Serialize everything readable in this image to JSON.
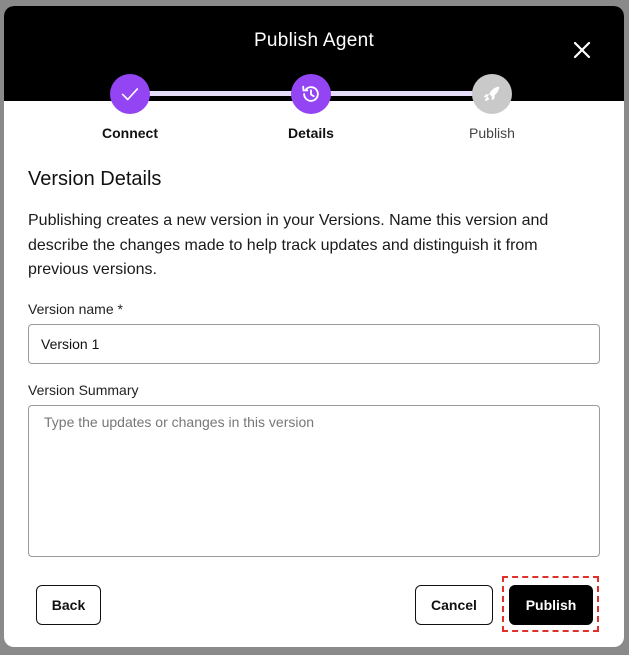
{
  "dialog": {
    "title": "Publish Agent",
    "close_icon": "close-icon"
  },
  "stepper": {
    "steps": [
      {
        "label": "Connect",
        "state": "complete",
        "icon": "check-icon"
      },
      {
        "label": "Details",
        "state": "active",
        "icon": "history-icon"
      },
      {
        "label": "Publish",
        "state": "pending",
        "icon": "rocket-icon"
      }
    ],
    "colors": {
      "accent": "#9345f3",
      "track": "#e6ddfb",
      "pending": "#c9c9c9"
    }
  },
  "content": {
    "section_title": "Version Details",
    "description": "Publishing creates a new version in your Versions. Name this version and describe the changes made to help track updates and distinguish it from previous versions."
  },
  "form": {
    "version_name": {
      "label": "Version name *",
      "value": "Version 1"
    },
    "version_summary": {
      "label": "Version Summary",
      "placeholder": "Type the updates or changes in this version",
      "value": ""
    }
  },
  "footer": {
    "back_label": "Back",
    "cancel_label": "Cancel",
    "publish_label": "Publish"
  }
}
